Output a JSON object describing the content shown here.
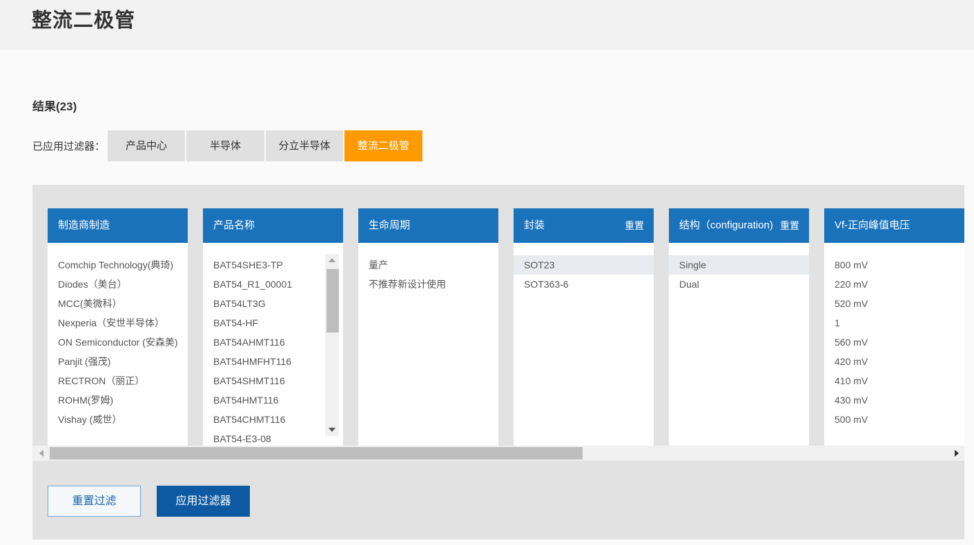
{
  "page": {
    "title": "整流二极管"
  },
  "results": {
    "label": "结果(23)"
  },
  "applied_filters": {
    "label": "已应用过滤器：",
    "chips": [
      {
        "label": "产品中心",
        "active": false
      },
      {
        "label": "半导体",
        "active": false
      },
      {
        "label": "分立半导体",
        "active": false
      },
      {
        "label": "整流二极管",
        "active": true
      }
    ]
  },
  "columns": [
    {
      "header": "制造商制造",
      "reset": "",
      "items": [
        "Comchip Technology(典琦)",
        "Diodes（美台）",
        "MCC(美微科）",
        "Nexperia（安世半导体）",
        "ON Semiconductor (安森美)",
        "Panjit (强茂)",
        "RECTRON（丽正）",
        "ROHM(罗姆)",
        "Vishay (威世）"
      ]
    },
    {
      "header": "产品名称",
      "reset": "",
      "items": [
        "BAT54SHE3-TP",
        "BAT54_R1_00001",
        "BAT54LT3G",
        "BAT54-HF",
        "BAT54AHMT116",
        "BAT54HMFHT116",
        "BAT54SHMT116",
        "BAT54HMT116",
        "BAT54CHMT116",
        "BAT54-E3-08"
      ]
    },
    {
      "header": "生命周期",
      "reset": "",
      "items": [
        "量产",
        "不推荐新设计使用"
      ]
    },
    {
      "header": "封装",
      "reset": "重置",
      "items": [
        "SOT23",
        "SOT363-6"
      ],
      "selected": 0
    },
    {
      "header": "结构（configuration)",
      "reset": "重置",
      "items": [
        "Single",
        "Dual"
      ],
      "selected": 0
    },
    {
      "header": "Vf-正向峰值电压",
      "reset": "",
      "items": [
        "800 mV",
        "220 mV",
        "520 mV",
        "1",
        "560 mV",
        "420 mV",
        "410 mV",
        "430 mV",
        "500 mV"
      ]
    }
  ],
  "buttons": {
    "reset": "重置过滤",
    "apply": "应用过滤器"
  }
}
